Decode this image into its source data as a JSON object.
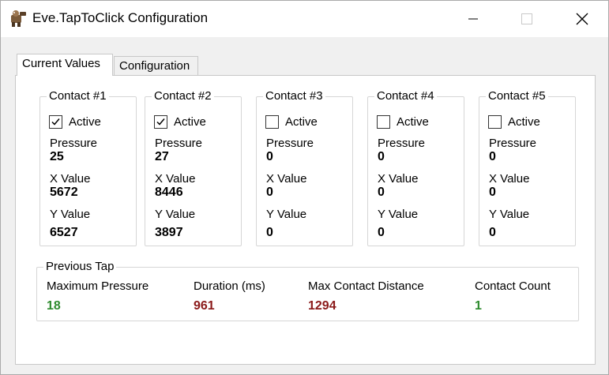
{
  "window": {
    "title": "Eve.TapToClick Configuration"
  },
  "tabs": [
    {
      "label": "Current Values",
      "active": true
    },
    {
      "label": "Configuration",
      "active": false
    }
  ],
  "contacts": [
    {
      "title": "Contact #1",
      "active_label": "Active",
      "active": true,
      "pressure_label": "Pressure",
      "pressure": "25",
      "x_label": "X Value",
      "x": "5672",
      "y_label": "Y Value",
      "y": "6527"
    },
    {
      "title": "Contact #2",
      "active_label": "Active",
      "active": true,
      "pressure_label": "Pressure",
      "pressure": "27",
      "x_label": "X Value",
      "x": "8446",
      "y_label": "Y Value",
      "y": "3897"
    },
    {
      "title": "Contact #3",
      "active_label": "Active",
      "active": false,
      "pressure_label": "Pressure",
      "pressure": "0",
      "x_label": "X Value",
      "x": "0",
      "y_label": "Y Value",
      "y": "0"
    },
    {
      "title": "Contact #4",
      "active_label": "Active",
      "active": false,
      "pressure_label": "Pressure",
      "pressure": "0",
      "x_label": "X Value",
      "x": "0",
      "y_label": "Y Value",
      "y": "0"
    },
    {
      "title": "Contact #5",
      "active_label": "Active",
      "active": false,
      "pressure_label": "Pressure",
      "pressure": "0",
      "x_label": "X Value",
      "x": "0",
      "y_label": "Y Value",
      "y": "0"
    }
  ],
  "previous_tap": {
    "title": "Previous Tap",
    "max_pressure_label": "Maximum Pressure",
    "max_pressure": "18",
    "duration_label": "Duration (ms)",
    "duration": "961",
    "max_distance_label": "Max Contact Distance",
    "max_distance": "1294",
    "contact_count_label": "Contact Count",
    "contact_count": "1"
  },
  "colors": {
    "good": "#2e8b2e",
    "bad": "#8b1a1a"
  },
  "icons": {
    "app": "app-icon",
    "minimize": "minimize-icon",
    "maximize": "maximize-icon",
    "close": "close-icon",
    "checkmark": "checkmark-icon"
  }
}
